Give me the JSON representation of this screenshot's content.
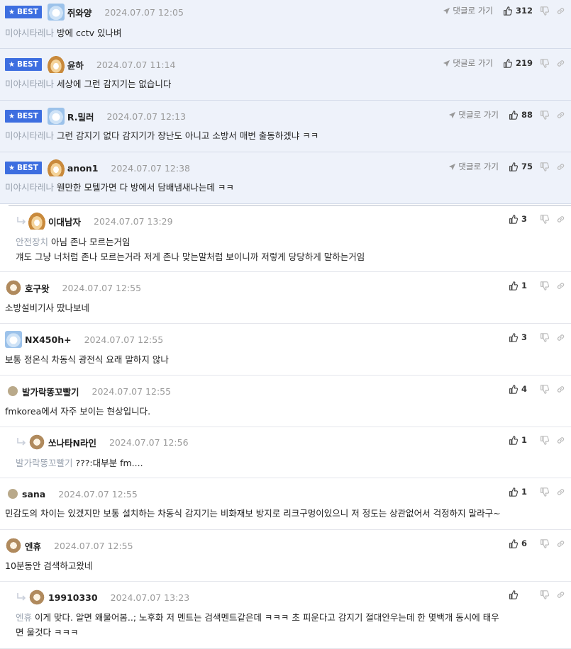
{
  "labels": {
    "best_badge": "BEST",
    "goto_reply": "댓글로 가기"
  },
  "comments": [
    {
      "best": true,
      "reply": false,
      "avatar": "blue",
      "nick": "쥐와양",
      "date": "2024.07.07 12:05",
      "votes": "312",
      "target": "미야시타레나",
      "lines": [
        "방에 cctv 있나벼"
      ]
    },
    {
      "best": true,
      "reply": false,
      "avatar": "fox",
      "nick": "윤하",
      "date": "2024.07.07 11:14",
      "votes": "219",
      "target": "미야시타레나",
      "lines": [
        "세상에 그런 감지기는 없습니다"
      ]
    },
    {
      "best": true,
      "reply": false,
      "avatar": "blue",
      "nick": "R.밀러",
      "date": "2024.07.07 12:13",
      "votes": "88",
      "target": "미야시타레나",
      "lines": [
        "그런 감지기 없다 감지기가 장난도 아니고 소방서 매번 출동하겠냐 ㅋㅋ"
      ]
    },
    {
      "best": true,
      "reply": false,
      "avatar": "fox",
      "nick": "anon1",
      "date": "2024.07.07 12:38",
      "votes": "75",
      "target": "미야시타레나",
      "lines": [
        "웬만한 모텔가면 다 방에서 담배냄새나는데 ㅋㅋ"
      ]
    },
    {
      "best": false,
      "reply": true,
      "avatar": "fox",
      "nick": "이대남자",
      "date": "2024.07.07 13:29",
      "votes": "3",
      "target": "안전장치",
      "lines": [
        "아님 존나 모르는거임",
        "걔도 그냥 너처럼 존나 모르는거라 저게 존나 맞는말처럼 보이니까 저렇게 당당하게 말하는거임"
      ]
    },
    {
      "best": false,
      "reply": false,
      "avatar": "dog",
      "nick": "호구왓",
      "date": "2024.07.07 12:55",
      "votes": "1",
      "target": "",
      "lines": [
        "소방설비기사 땄나보네"
      ]
    },
    {
      "best": false,
      "reply": false,
      "avatar": "blue",
      "nick": "NX450h+",
      "date": "2024.07.07 12:55",
      "votes": "3",
      "target": "",
      "lines": [
        "보통 정온식 차동식 광전식 요래 말하지 않나"
      ]
    },
    {
      "best": false,
      "reply": false,
      "avatar": "dot",
      "nick": "발가락똥꼬빨기",
      "date": "2024.07.07 12:55",
      "votes": "4",
      "target": "",
      "lines": [
        "fmkorea에서 자주 보이는 현상입니다."
      ]
    },
    {
      "best": false,
      "reply": true,
      "avatar": "dog",
      "nick": "쏘나타N라인",
      "date": "2024.07.07 12:56",
      "votes": "1",
      "target": "발가락똥꼬빨기",
      "lines": [
        "???:대부분 fm...."
      ]
    },
    {
      "best": false,
      "reply": false,
      "avatar": "dot",
      "nick": "sana",
      "date": "2024.07.07 12:55",
      "votes": "1",
      "target": "",
      "lines": [
        "민감도의 차이는 있겠지만 보통 설치하는 차동식 감지기는 비화재보 방지로 리크구멍이있으니 저 정도는 상관없어서 걱정하지 말라구~"
      ]
    },
    {
      "best": false,
      "reply": false,
      "avatar": "dog",
      "nick": "엔휴",
      "date": "2024.07.07 12:55",
      "votes": "6",
      "target": "",
      "lines": [
        "10분동안 검색하고왔네"
      ]
    },
    {
      "best": false,
      "reply": true,
      "avatar": "dog",
      "nick": "19910330",
      "date": "2024.07.07 13:23",
      "votes": "",
      "target": "엔휴",
      "lines": [
        "이게 맞다. 알면 왜물어봄..; 노후화 저 멘트는 검색멘트같은데 ㅋㅋㅋ 초 피운다고 감지기 절대안우는데 한 몇백개 동시에 태우",
        "면 울것다 ㅋㅋㅋ"
      ]
    }
  ]
}
